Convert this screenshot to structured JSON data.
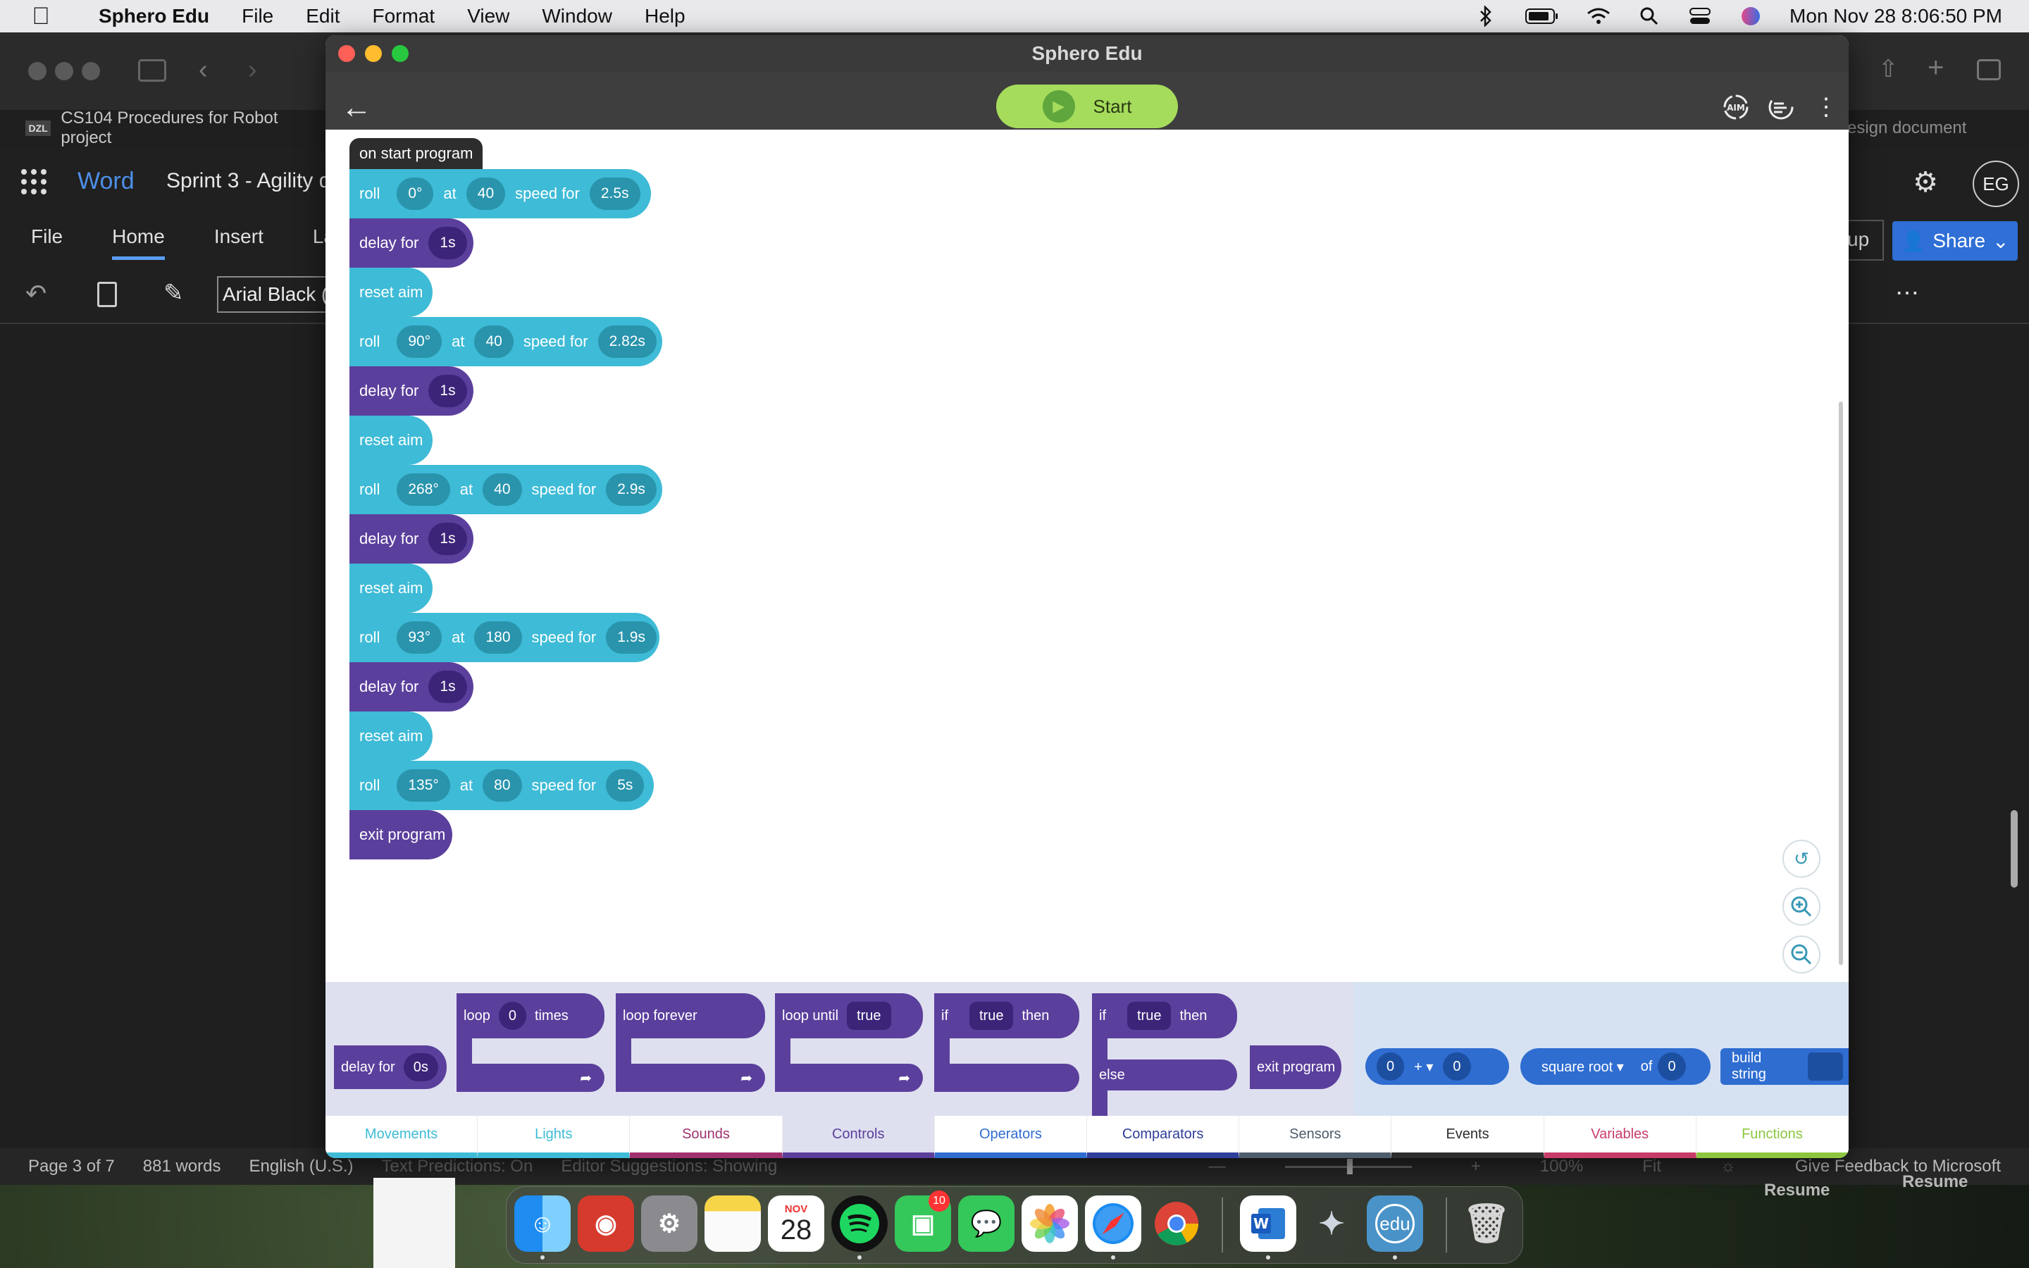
{
  "menubar": {
    "app": "Sphero Edu",
    "items": [
      "File",
      "Edit",
      "Format",
      "View",
      "Window",
      "Help"
    ],
    "datetime": "Mon Nov 28  8:06:50 PM"
  },
  "word": {
    "doc_tab": "CS104 Procedures for Robot project",
    "doc_tab_icon": "DZL",
    "app_name": "Word",
    "doc_title": "Sprint 3 - Agility d",
    "tabs": [
      "File",
      "Home",
      "Insert",
      "La"
    ],
    "font": "Arial Black (I",
    "right_tab_text": "esign document",
    "up_label": "up",
    "share": "Share",
    "avatar": "EG",
    "status": {
      "page": "Page 3 of 7",
      "words": "881 words",
      "lang": "English (U.S.)",
      "predictions": "Text Predictions: On",
      "suggestions": "Editor Suggestions: Showing",
      "zoom": "100%",
      "fit": "Fit",
      "feedback": "Give Feedback to Microsoft"
    }
  },
  "sphero": {
    "title": "Sphero Edu",
    "start": "Start",
    "hat": "on start program",
    "program": [
      {
        "type": "roll",
        "label": "roll",
        "heading": "0°",
        "at": "at",
        "speed": "40",
        "speed_for": "speed for",
        "time": "2.5s"
      },
      {
        "type": "delay",
        "label": "delay for",
        "time": "1s"
      },
      {
        "type": "reset",
        "label": "reset aim"
      },
      {
        "type": "roll",
        "label": "roll",
        "heading": "90°",
        "at": "at",
        "speed": "40",
        "speed_for": "speed for",
        "time": "2.82s"
      },
      {
        "type": "delay",
        "label": "delay for",
        "time": "1s"
      },
      {
        "type": "reset",
        "label": "reset aim"
      },
      {
        "type": "roll",
        "label": "roll",
        "heading": "268°",
        "at": "at",
        "speed": "40",
        "speed_for": "speed for",
        "time": "2.9s"
      },
      {
        "type": "delay",
        "label": "delay for",
        "time": "1s"
      },
      {
        "type": "reset",
        "label": "reset aim"
      },
      {
        "type": "roll",
        "label": "roll",
        "heading": "93°",
        "at": "at",
        "speed": "180",
        "speed_for": "speed for",
        "time": "1.9s"
      },
      {
        "type": "delay",
        "label": "delay for",
        "time": "1s"
      },
      {
        "type": "reset",
        "label": "reset aim"
      },
      {
        "type": "roll",
        "label": "roll",
        "heading": "135°",
        "at": "at",
        "speed": "80",
        "speed_for": "speed for",
        "time": "5s"
      },
      {
        "type": "exit",
        "label": "exit program"
      }
    ],
    "palette": {
      "delay": {
        "label": "delay for",
        "value": "0s"
      },
      "loop": {
        "label": "loop",
        "value": "0",
        "suffix": "times"
      },
      "loop_forever": "loop forever",
      "loop_until": {
        "label": "loop until",
        "value": "true"
      },
      "if_then": {
        "if": "if",
        "cond": "true",
        "then": "then"
      },
      "if_else": {
        "if": "if",
        "cond": "true",
        "then": "then",
        "else": "else"
      },
      "exit": "exit program",
      "operator": {
        "a": "0",
        "op": "+",
        "b": "0"
      },
      "math": {
        "fn": "square root",
        "of": "of",
        "value": "0"
      },
      "string": "build string"
    },
    "tabs": [
      {
        "label": "Movements",
        "color": "#3ebbd6"
      },
      {
        "label": "Lights",
        "color": "#3ebbd6"
      },
      {
        "label": "Sounds",
        "color": "#a0306d"
      },
      {
        "label": "Controls",
        "color": "#5b3f9c"
      },
      {
        "label": "Operators",
        "color": "#2f6dd1"
      },
      {
        "label": "Comparators",
        "color": "#2f3d9b"
      },
      {
        "label": "Sensors",
        "color": "#4e5d6b"
      },
      {
        "label": "Events",
        "color": "#2d2d2d"
      },
      {
        "label": "Variables",
        "color": "#c93c68"
      },
      {
        "label": "Functions",
        "color": "#8cc63f"
      }
    ]
  },
  "dock": {
    "calendar_month": "NOV",
    "calendar_day": "28",
    "facetime_badge": "10",
    "edu_label": "edu",
    "resume": [
      "Resume",
      "Resume"
    ]
  }
}
